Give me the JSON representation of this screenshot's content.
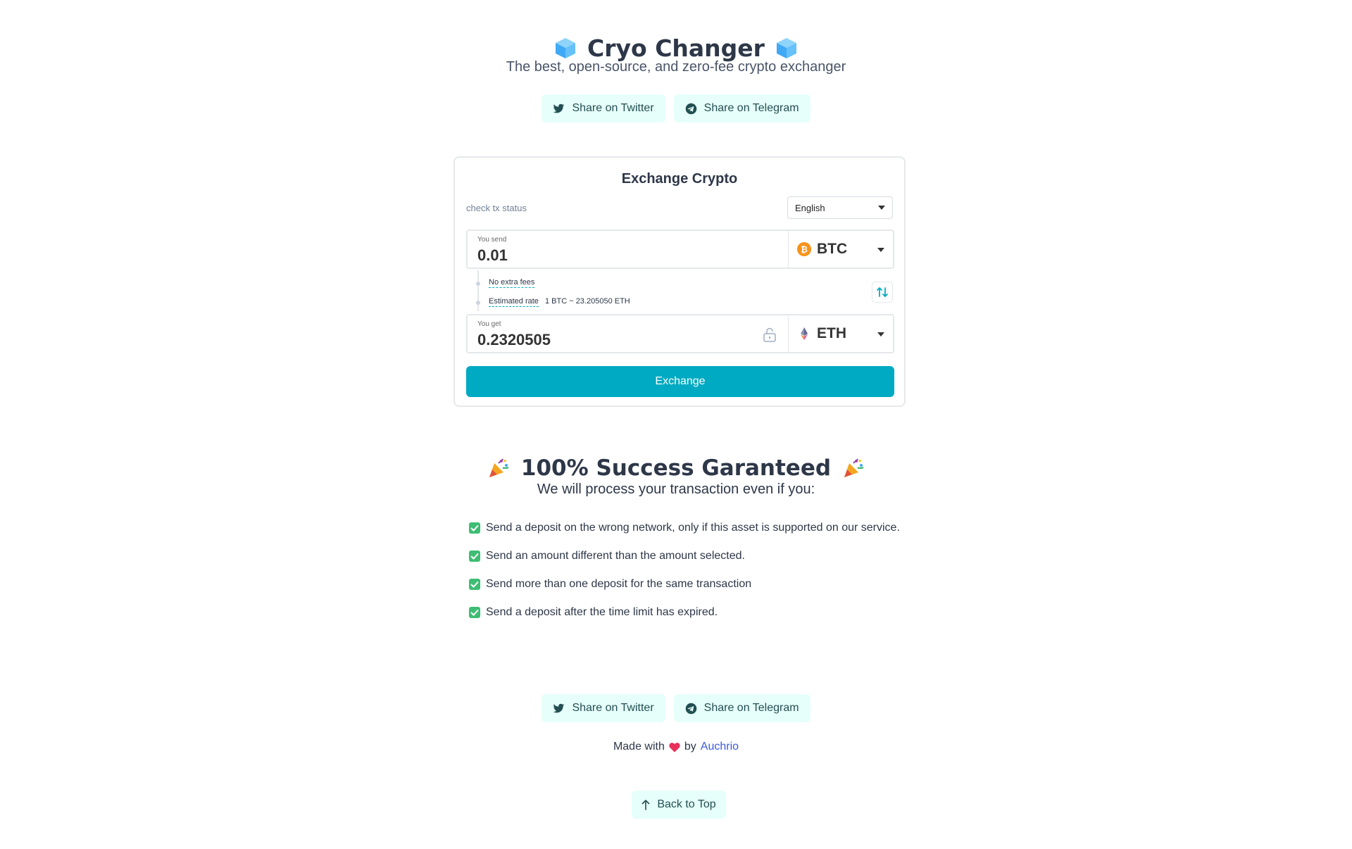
{
  "header": {
    "title": "Cryo Changer",
    "subtitle": "The best, open-source, and zero-fee crypto exchanger",
    "title_icon": "ice-cube-icon"
  },
  "share": {
    "twitter_label": "Share on Twitter",
    "telegram_label": "Share on Telegram"
  },
  "card": {
    "title": "Exchange Crypto",
    "check_tx": "check tx status",
    "language": "English",
    "send": {
      "label": "You send",
      "value": "0.01",
      "coin": "BTC",
      "coin_icon": "bitcoin-icon",
      "coin_color": "#f7931a"
    },
    "info": {
      "no_fees": "No extra fees",
      "rate_label": "Estimated rate",
      "rate_value": "1 BTC ~ 23.205050 ETH"
    },
    "get": {
      "label": "You get",
      "value": "0.2320505",
      "coin": "ETH",
      "coin_icon": "ethereum-icon"
    },
    "exchange_label": "Exchange",
    "accent_color": "#00aac2"
  },
  "success": {
    "title": "100% Success Garanteed",
    "subtitle": "We will process your transaction even if you:",
    "items": [
      "Send a deposit on the wrong network, only if this asset is supported on our service.",
      "Send an amount different than the amount selected.",
      "Send more than one deposit for the same transaction",
      "Send a deposit after the time limit has expired."
    ]
  },
  "footer": {
    "made_with": "Made with",
    "by": "by",
    "author": "Auchrio",
    "back_to_top": "Back to Top"
  }
}
